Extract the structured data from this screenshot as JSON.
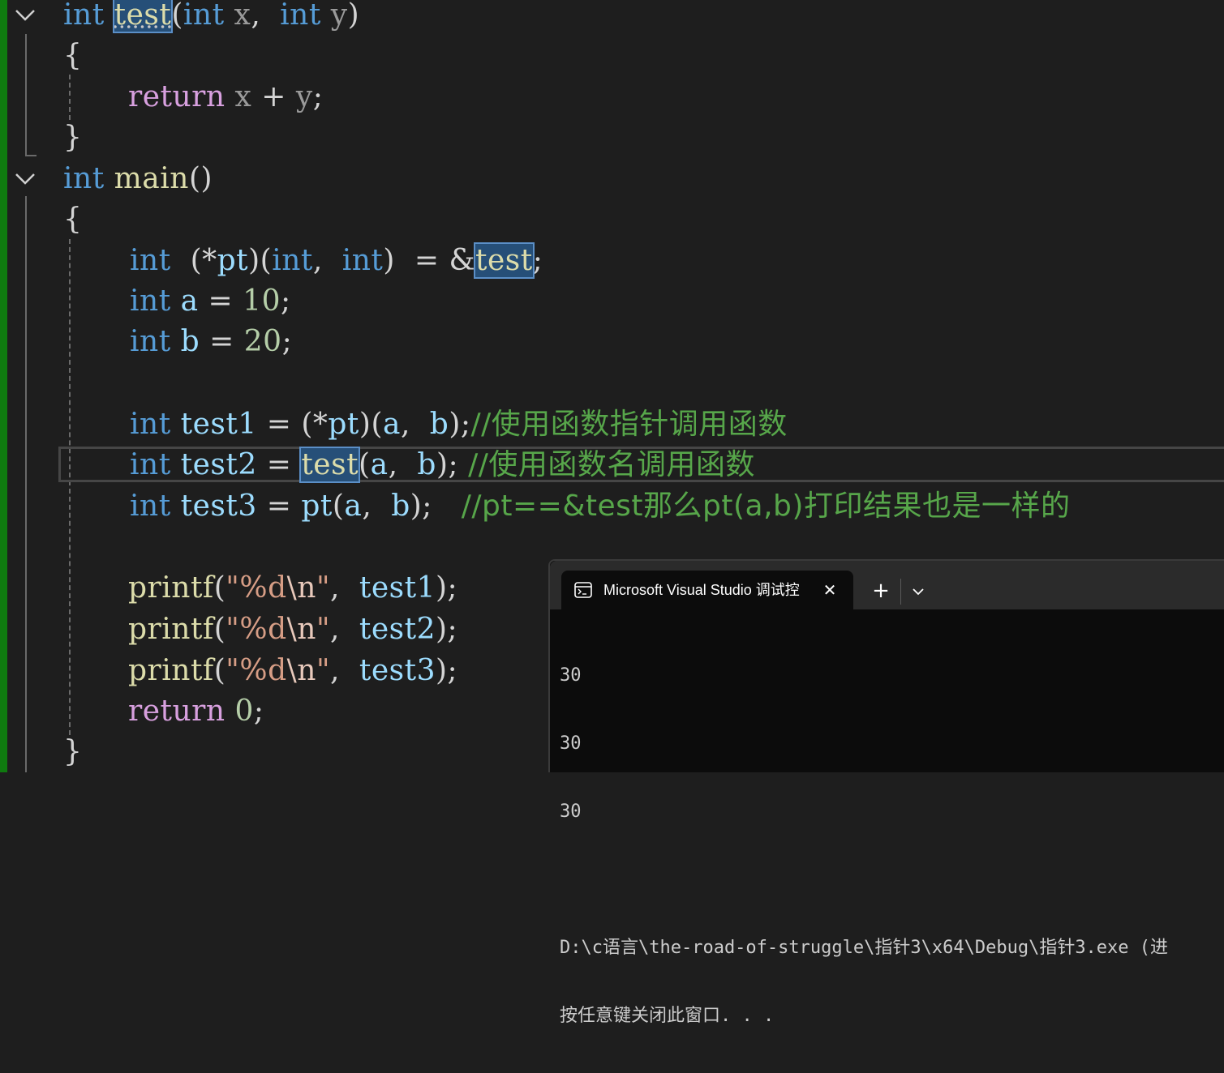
{
  "editor": {
    "lines": {
      "l1": {
        "kw1": "int",
        "fn": "test",
        "p1": "(",
        "kw2": "int",
        "x": "x",
        "comma": ",",
        "kw3": "int",
        "y": "y",
        "p2": ")"
      },
      "l2": {
        "brace": "{"
      },
      "l3": {
        "ret": "return",
        "x": "x",
        "op": "+",
        "y": "y",
        "semi": ";"
      },
      "l4": {
        "brace": "}"
      },
      "l5": {
        "kw": "int",
        "fn": "main",
        "parens": "()"
      },
      "l6": {
        "brace": "{"
      },
      "l7": {
        "kw1": "int",
        "p1": "(",
        "star": "*",
        "pt": "pt",
        "p2": ")",
        "p3": "(",
        "kw2": "int",
        "comma": ",",
        "kw3": "int",
        "p4": ")",
        "eq": "=",
        "amp": "&",
        "fn": "test",
        "semi": ";"
      },
      "l8": {
        "kw": "int",
        "v": "a",
        "eq": "=",
        "num": "10",
        "semi": ";"
      },
      "l9": {
        "kw": "int",
        "v": "b",
        "eq": "=",
        "num": "20",
        "semi": ";"
      },
      "l11": {
        "kw": "int",
        "v": "test1",
        "eq": "=",
        "p1": "(",
        "star": "*",
        "pt": "pt",
        "p2": ")",
        "p3": "(",
        "a": "a",
        "comma": ",",
        "b": "b",
        "p4": ")",
        "semi": ";",
        "comment": "//使用函数指针调用函数"
      },
      "l12": {
        "kw": "int",
        "v": "test2",
        "eq": "=",
        "fn": "test",
        "p1": "(",
        "a": "a",
        "comma": ",",
        "b": "b",
        "p2": ")",
        "semi": ";",
        "comment": "//使用函数名调用函数"
      },
      "l13": {
        "kw": "int",
        "v": "test3",
        "eq": "=",
        "pt": "pt",
        "p1": "(",
        "a": "a",
        "comma": ",",
        "b": "b",
        "p2": ")",
        "semi": ";",
        "comment": "//pt==&test那么pt(a,b)打印结果也是一样的"
      },
      "l15": {
        "fn": "printf",
        "p1": "(",
        "q1": "\"",
        "fmt": "%d",
        "esc": "\\n",
        "q2": "\"",
        "comma": ",",
        "v": "test1",
        "p2": ")",
        "semi": ";"
      },
      "l16": {
        "fn": "printf",
        "p1": "(",
        "q1": "\"",
        "fmt": "%d",
        "esc": "\\n",
        "q2": "\"",
        "comma": ",",
        "v": "test2",
        "p2": ")",
        "semi": ";"
      },
      "l17": {
        "fn": "printf",
        "p1": "(",
        "q1": "\"",
        "fmt": "%d",
        "esc": "\\n",
        "q2": "\"",
        "comma": ",",
        "v": "test3",
        "p2": ")",
        "semi": ";"
      },
      "l18": {
        "ret": "return",
        "num": "0",
        "semi": ";"
      },
      "l19": {
        "brace": "}"
      }
    },
    "colors": {
      "keyword": "#569cd6",
      "function": "#dcdcaa",
      "local": "#9cdcfe",
      "number": "#b5cea8",
      "string": "#d69d85",
      "comment": "#57a64a",
      "control": "#d8a0df",
      "background": "#1e1e1e",
      "git_bar": "#0f7a0f"
    }
  },
  "console": {
    "tab_icon": "terminal-icon",
    "tab_title": "Microsoft Visual Studio 调试控",
    "close_glyph": "✕",
    "new_tab_glyph": "+",
    "dropdown_icon": "chevron-down-icon",
    "output": [
      "30",
      "30",
      "30",
      "",
      "D:\\c语言\\the-road-of-struggle\\指针3\\x64\\Debug\\指针3.exe (进",
      "按任意键关闭此窗口. . ."
    ]
  }
}
